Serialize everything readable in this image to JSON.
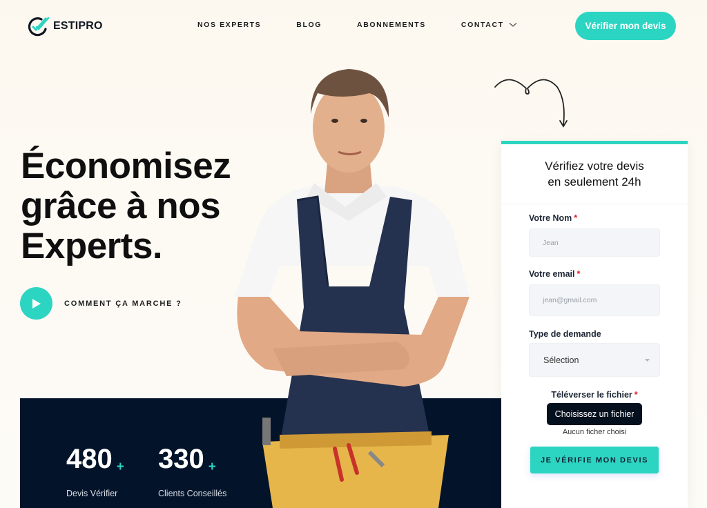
{
  "brand": {
    "name": "ESTIPRO",
    "accent_color": "#2cd5c2",
    "dark_color": "#03142a"
  },
  "nav": {
    "items": [
      {
        "label": "NOS EXPERTS"
      },
      {
        "label": "BLOG"
      },
      {
        "label": "ABONNEMENTS"
      },
      {
        "label": "CONTACT",
        "icon": "chevron-down-icon"
      }
    ],
    "cta_label": "Vérifier mon devis"
  },
  "hero": {
    "title": "Économisez\ngrâce à nos\nExperts.",
    "how_label": "COMMENT ÇA MARCHE ?",
    "play_icon": "play-icon"
  },
  "stats": [
    {
      "value": "480",
      "suffix": "+",
      "label": "Devis Vérifier"
    },
    {
      "value": "330",
      "suffix": "+",
      "label": "Clients Conseillés"
    }
  ],
  "form": {
    "title": "Vérifiez votre devis\nen seulement 24h",
    "name_label": "Votre Nom",
    "name_placeholder": "Jean",
    "email_label": "Votre email",
    "email_placeholder": "jean@gmail.com",
    "type_label": "Type de demande",
    "type_value": "Sélection",
    "upload_label": "Téléverser le fichier",
    "upload_button": "Choisissez un fichier",
    "upload_status": "Aucun ficher choisi",
    "required_mark": "*",
    "submit_label": "JE VÉRIFIE MON DEVIS"
  }
}
